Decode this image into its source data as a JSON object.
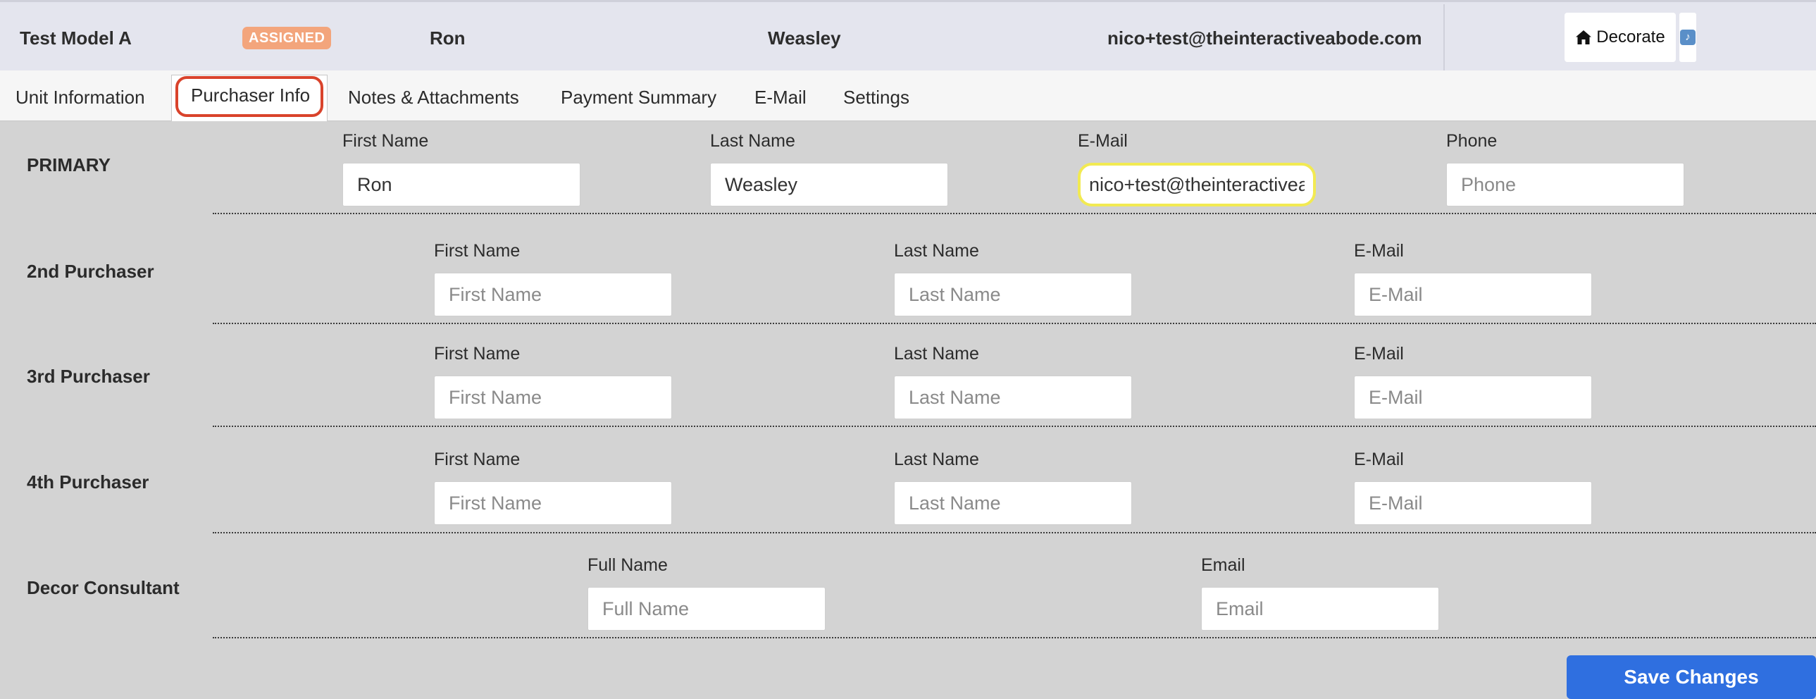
{
  "header": {
    "model": "Test Model A",
    "status_badge": "ASSIGNED",
    "first_name": "Ron",
    "last_name": "Weasley",
    "email": "nico+test@theinteractiveabode.com",
    "decorate_label": "Decorate"
  },
  "tabs": [
    {
      "label": "Unit Information"
    },
    {
      "label": "Purchaser Info",
      "active": true
    },
    {
      "label": "Notes & Attachments"
    },
    {
      "label": "Payment Summary"
    },
    {
      "label": "E-Mail"
    },
    {
      "label": "Settings"
    }
  ],
  "primary": {
    "label": "PRIMARY",
    "first_name_label": "First Name",
    "first_name_value": "Ron",
    "last_name_label": "Last Name",
    "last_name_value": "Weasley",
    "email_label": "E-Mail",
    "email_value": "nico+test@theinteractiveabode.com",
    "phone_label": "Phone",
    "phone_placeholder": "Phone"
  },
  "purchasers": [
    {
      "label": "2nd Purchaser",
      "first_name_label": "First Name",
      "first_name_placeholder": "First Name",
      "last_name_label": "Last Name",
      "last_name_placeholder": "Last Name",
      "email_label": "E-Mail",
      "email_placeholder": "E-Mail"
    },
    {
      "label": "3rd Purchaser",
      "first_name_label": "First Name",
      "first_name_placeholder": "First Name",
      "last_name_label": "Last Name",
      "last_name_placeholder": "Last Name",
      "email_label": "E-Mail",
      "email_placeholder": "E-Mail"
    },
    {
      "label": "4th Purchaser",
      "first_name_label": "First Name",
      "first_name_placeholder": "First Name",
      "last_name_label": "Last Name",
      "last_name_placeholder": "Last Name",
      "email_label": "E-Mail",
      "email_placeholder": "E-Mail"
    }
  ],
  "decor": {
    "label": "Decor Consultant",
    "full_name_label": "Full Name",
    "full_name_placeholder": "Full Name",
    "email_label": "Email",
    "email_placeholder": "Email"
  },
  "save_label": "Save Changes",
  "colors": {
    "badge": "#f3a57c",
    "active_tab_highlight": "#d9432b",
    "email_field_highlight": "#f2ea52",
    "save_button": "#2f6fe0"
  },
  "icons": {
    "decorate": "home-icon",
    "side_tab": "music-note-icon"
  }
}
